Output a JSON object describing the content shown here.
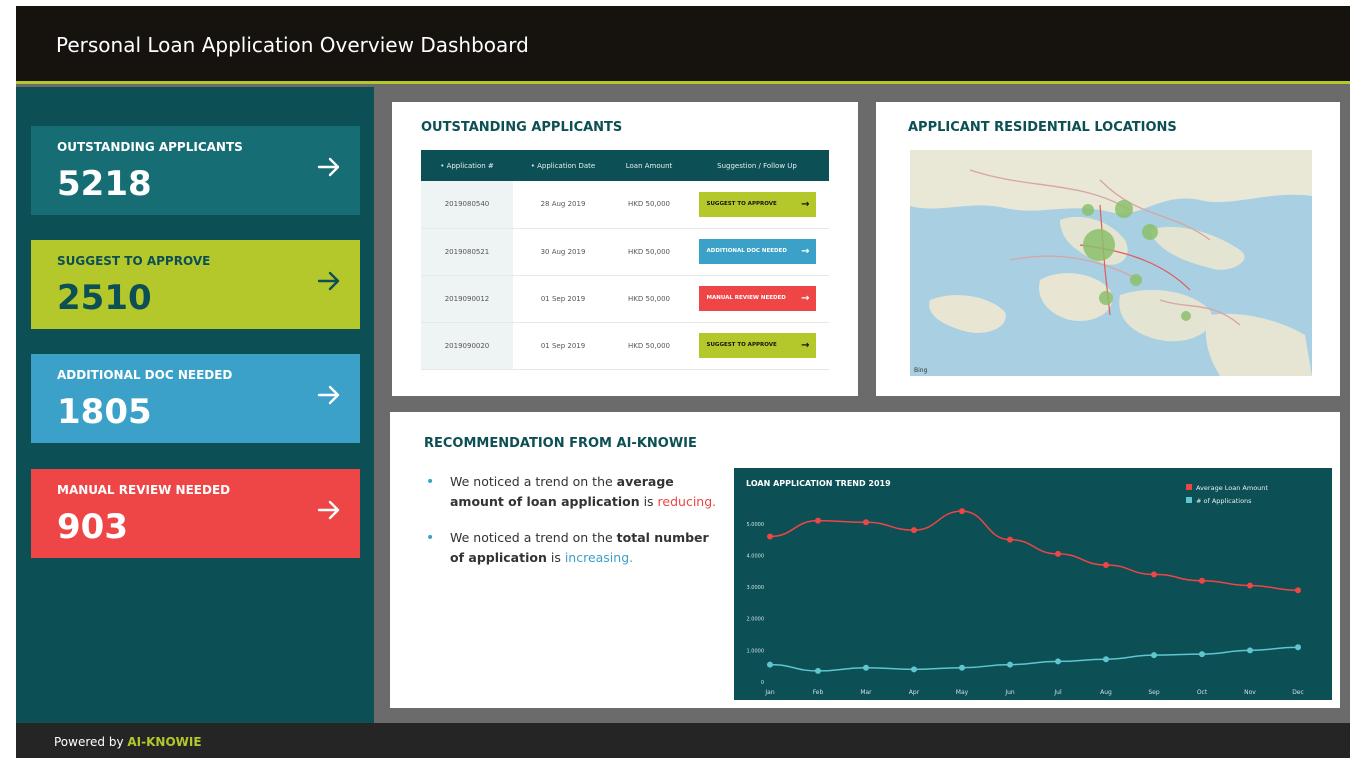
{
  "header": {
    "title": "Personal Loan Application Overview Dashboard"
  },
  "kpis": [
    {
      "label": "OUTSTANDING APPLICANTS",
      "value": "5218",
      "color": "#166e74"
    },
    {
      "label": "SUGGEST TO APPROVE",
      "value": "2510",
      "color": "#b5c82b"
    },
    {
      "label": "ADDITIONAL DOC NEEDED",
      "value": "1805",
      "color": "#3ba1c8"
    },
    {
      "label": "MANUAL REVIEW NEEDED",
      "value": "903",
      "color": "#ee4546"
    }
  ],
  "applicants": {
    "title": "OUTSTANDING APPLICANTS",
    "columns": [
      "• Application #",
      "• Application Date",
      "Loan Amount",
      "Suggestion / Follow Up"
    ],
    "rows": [
      {
        "id": "2019080540",
        "date": "28 Aug 2019",
        "amount": "HKD 50,000",
        "suggestion": "SUGGEST TO APPROVE",
        "color": "#b5c82b"
      },
      {
        "id": "2019080521",
        "date": "30 Aug 2019",
        "amount": "HKD 50,000",
        "suggestion": "ADDITIONAL DOC NEEDED",
        "color": "#3ba1c8"
      },
      {
        "id": "2019090012",
        "date": "01 Sep 2019",
        "amount": "HKD 50,000",
        "suggestion": "MANUAL REVIEW NEEDED",
        "color": "#ee4546"
      },
      {
        "id": "2019090020",
        "date": "01 Sep 2019",
        "amount": "HKD 50,000",
        "suggestion": "SUGGEST TO APPROVE",
        "color": "#b5c82b"
      }
    ]
  },
  "map": {
    "title": "APPLICANT RESIDENTIAL LOCATIONS",
    "logo": "Bing"
  },
  "recommendation": {
    "title": "RECOMMENDATION FROM AI-KNOWIE",
    "items": [
      {
        "pre": "We noticed a trend on the ",
        "bold": "average amount of loan application",
        "mid": " is ",
        "highlight": "reducing",
        "post": "."
      },
      {
        "pre": "We noticed a trend on the ",
        "bold": "total number of application",
        "mid": " is ",
        "highlight": "increasing",
        "post": "."
      }
    ]
  },
  "chart_data": {
    "type": "line",
    "title": "LOAN APPLICATION TREND 2019",
    "categories": [
      "Jan",
      "Feb",
      "Mar",
      "Apr",
      "May",
      "Jun",
      "Jul",
      "Aug",
      "Sep",
      "Oct",
      "Nov",
      "Dec"
    ],
    "yticks": [
      "0",
      "1.0000",
      "2.0000",
      "3.0000",
      "4.0000",
      "5.0000"
    ],
    "ylim": [
      0,
      5.5
    ],
    "grid": false,
    "legend_position": "top-right",
    "series": [
      {
        "name": "Average Loan Amount",
        "color": "#ee4546",
        "values": [
          4.6,
          5.1,
          5.05,
          4.8,
          5.4,
          4.5,
          4.05,
          3.7,
          3.4,
          3.2,
          3.05,
          2.9
        ]
      },
      {
        "name": "# of Applications",
        "color": "#5fc6d0",
        "values": [
          0.55,
          0.35,
          0.45,
          0.4,
          0.45,
          0.55,
          0.65,
          0.72,
          0.85,
          0.88,
          1.0,
          1.1
        ]
      }
    ]
  },
  "footer": {
    "powered_by": "Powered by",
    "brand": "AI-KNOWIE",
    "brand_color": "#b5c82b"
  }
}
